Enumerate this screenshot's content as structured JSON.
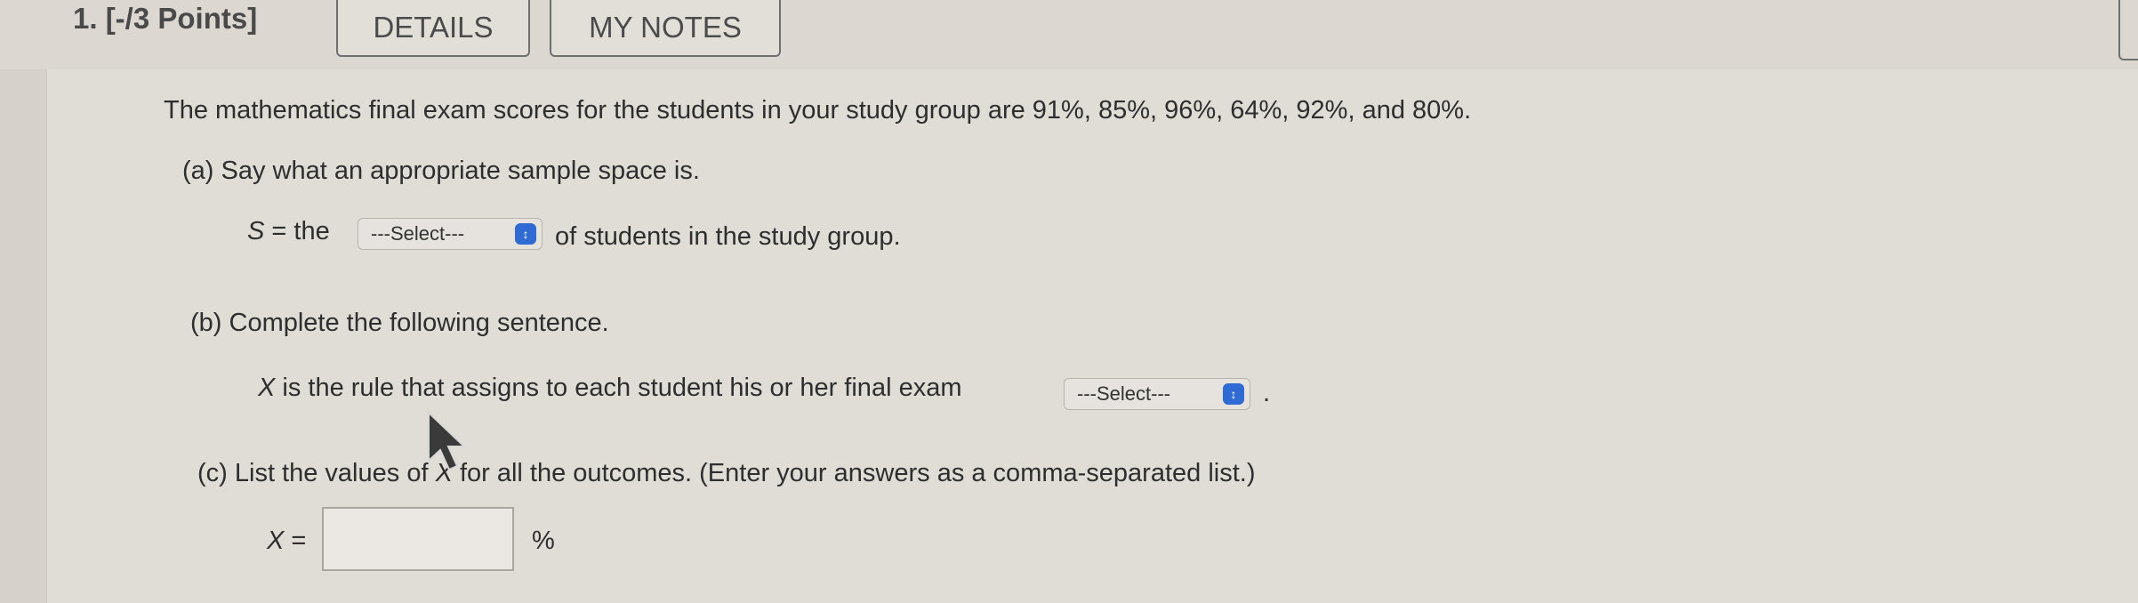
{
  "header": {
    "points": "1. [-/3 Points]",
    "details_label": "DETAILS",
    "notes_label": "MY NOTES"
  },
  "question": {
    "intro": "The mathematics final exam scores for the students in your study group are 91%, 85%, 96%, 64%, 92%, and 80%.",
    "part_a": {
      "label": "(a)  Say what an appropriate sample space is.",
      "s_var": "S",
      "s_prefix": " = the",
      "select_value": "---Select---",
      "suffix": "of students in the study group."
    },
    "part_b": {
      "label": "(b)  Complete the following sentence.",
      "x_var": "X",
      "rule_text": " is the rule that assigns to each student his or her final exam",
      "select_value": "---Select---",
      "period": "."
    },
    "part_c": {
      "label_before": "(c)  List the values of ",
      "x_var": "X",
      "label_after": " for all the outcomes. (Enter your answers as a comma-separated list.)",
      "eq_var": "X",
      "eq_sign": " =",
      "answer_value": "",
      "unit": "%"
    }
  },
  "icons": {
    "select_arrow": "chevron-updown-icon",
    "cursor": "mouse-pointer-icon"
  },
  "colors": {
    "background": "#d6d2cb",
    "panel": "#e0ddd7",
    "select_arrow_bg": "#2f6bd2"
  }
}
